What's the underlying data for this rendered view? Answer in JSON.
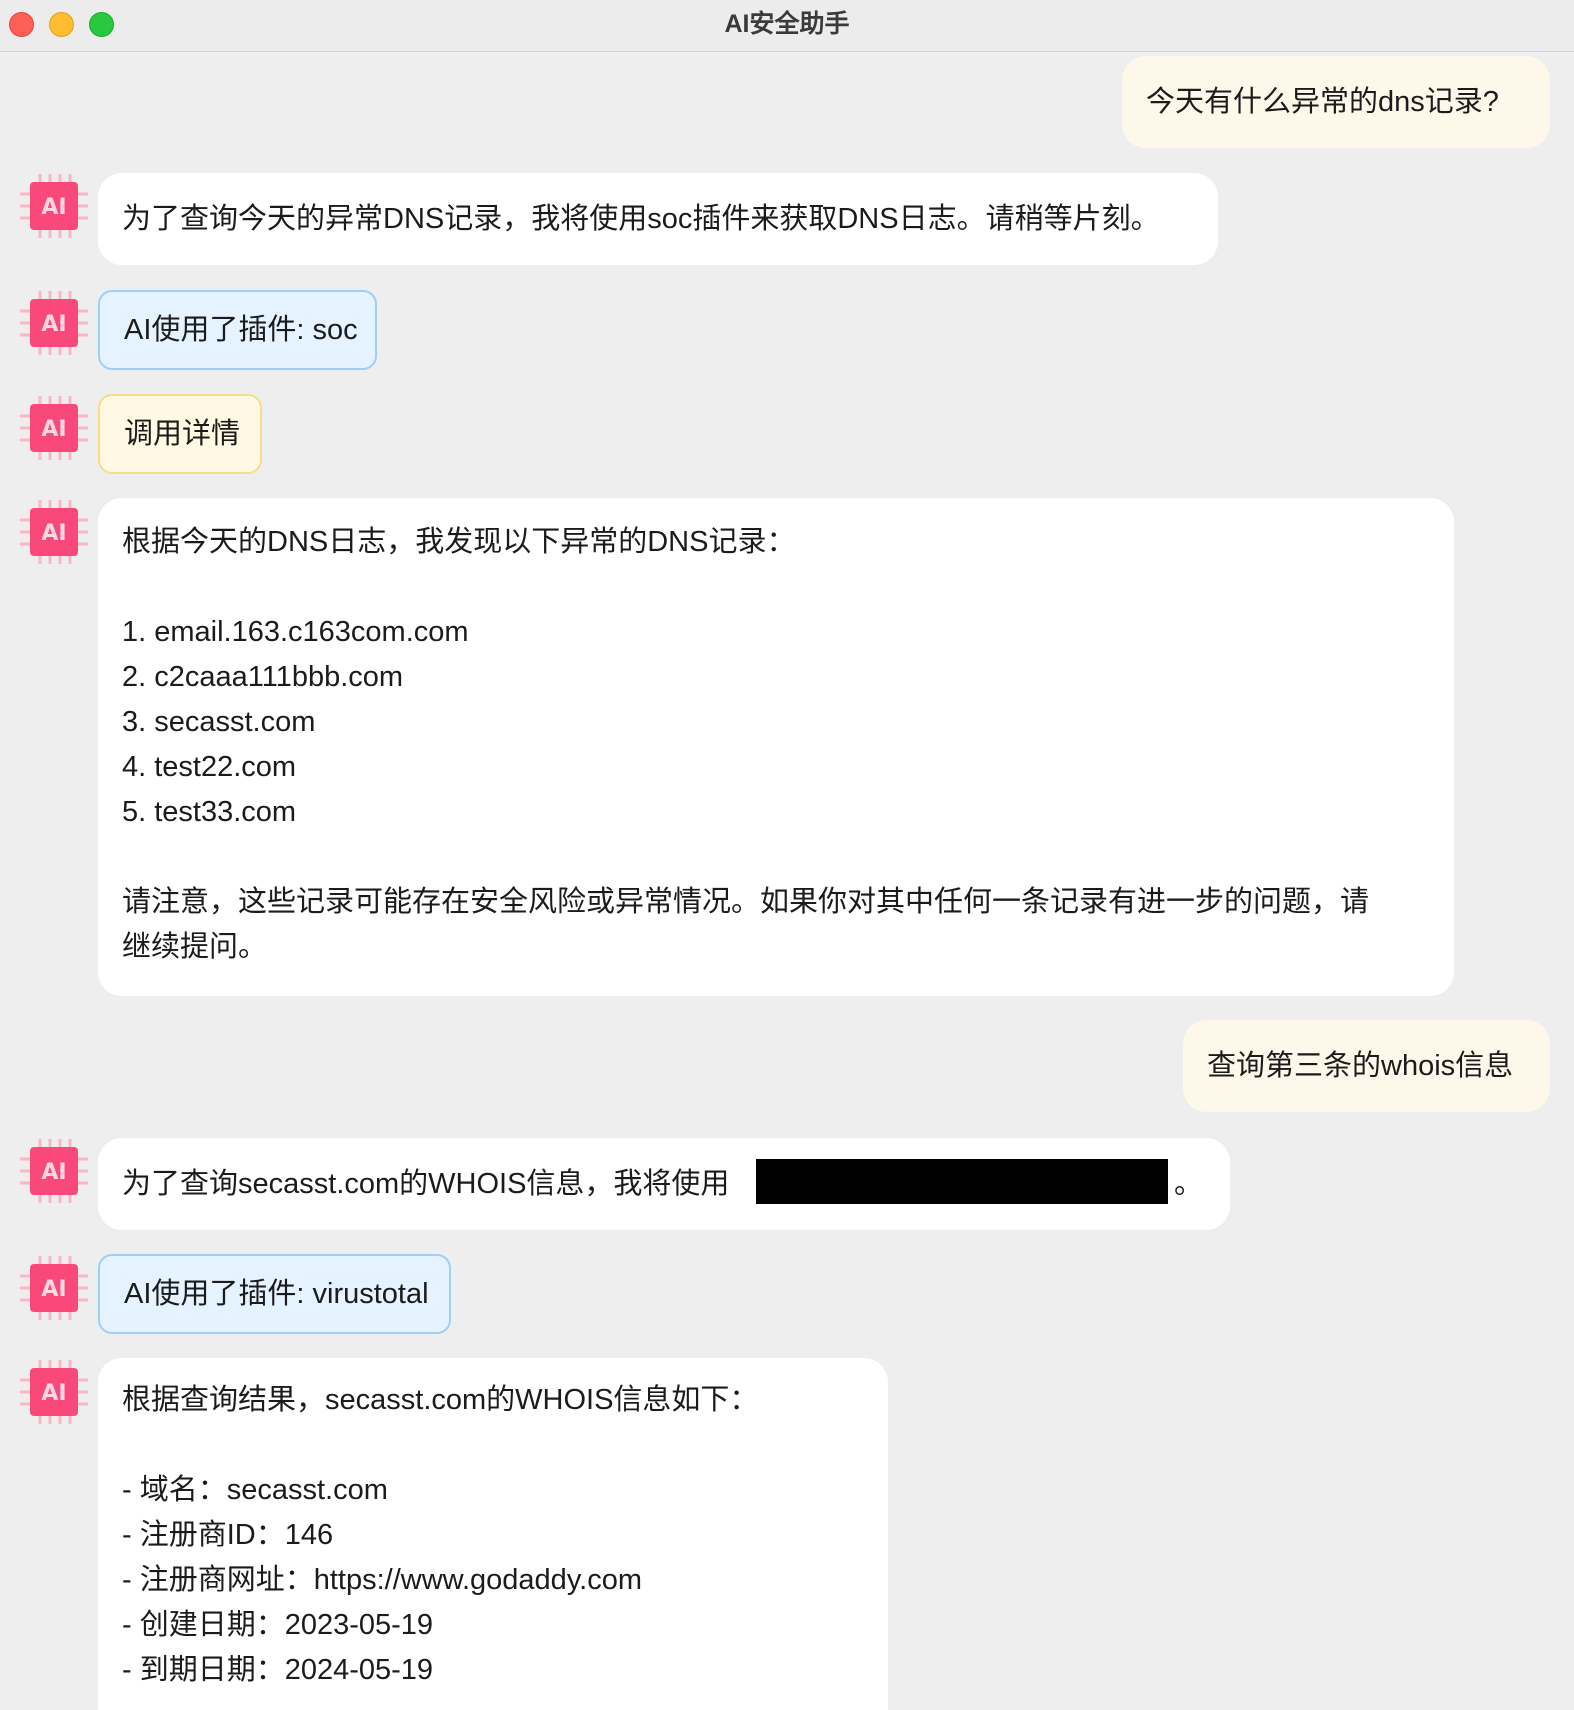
{
  "window": {
    "title": "AI安全助手"
  },
  "colors": {
    "user_bubble": "#fdf8ea",
    "ai_bubble": "#ffffff",
    "plugin_bubble": "#e5f2ff",
    "detail_bubble": "#fff8e2",
    "avatar_pink": "#f8497a"
  },
  "messages": {
    "user1": "今天有什么异常的dns记录?",
    "ai1": "为了查询今天的异常DNS记录，我将使用soc插件来获取DNS日志。请稍等片刻。",
    "plugin1": "AI使用了插件: soc",
    "detail1": "调用详情",
    "ai2": {
      "intro": "根据今天的DNS日志，我发现以下异常的DNS记录：",
      "items": [
        "1. email.163.c163com.com",
        "2. c2caaa111bbb.com",
        "3. secasst.com",
        "4. test22.com",
        "5. test33.com"
      ],
      "note_line1": "请注意，这些记录可能存在安全风险或异常情况。如果你对其中任何一条记录有进一步的问题，请",
      "note_line2": "继续提问。"
    },
    "user2": "查询第三条的whois信息",
    "ai3_visible_start": "为了查询secasst.com的WHOIS信息，我将使用",
    "ai3_visible_end": "。",
    "plugin2": "AI使用了插件: virustotal",
    "ai4": {
      "intro": "根据查询结果，secasst.com的WHOIS信息如下：",
      "items": [
        "- 域名：secasst.com",
        "- 注册商ID：146",
        "- 注册商网址：https://www.godaddy.com",
        "- 创建日期：2023-05-19",
        "- 到期日期：2024-05-19"
      ]
    }
  },
  "icons": {
    "ai_avatar": "ai-chip-icon"
  }
}
